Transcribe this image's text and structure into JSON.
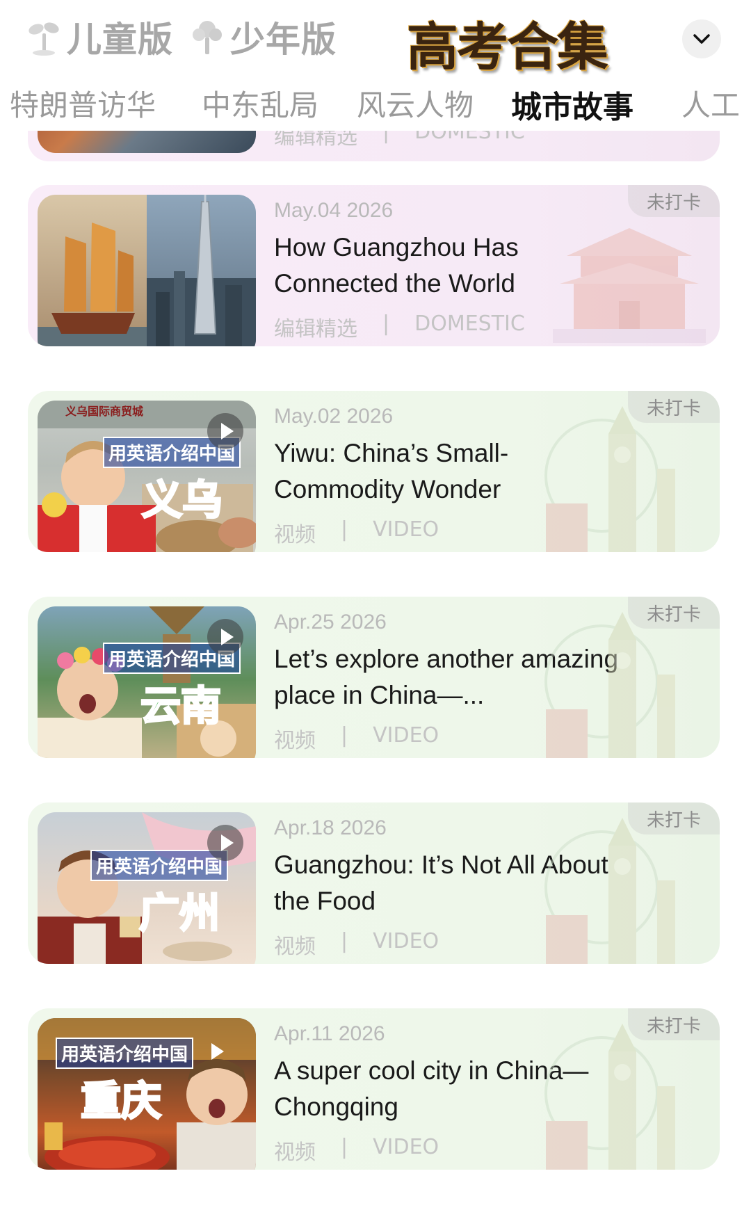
{
  "header": {
    "editions": [
      {
        "label": "儿童版",
        "icon": "sprout-icon"
      },
      {
        "label": "少年版",
        "icon": "tree-icon"
      }
    ],
    "collection_title": "高考合集",
    "expand_icon": "chevron-down-icon"
  },
  "tabs": [
    {
      "label": "特朗普访华"
    },
    {
      "label": "中东乱局"
    },
    {
      "label": "风云人物"
    },
    {
      "label": "城市故事",
      "active": true
    },
    {
      "label": "人工"
    }
  ],
  "partial_card": {
    "meta_left": "编辑精选",
    "meta_sep": "|",
    "meta_right": "DOMESTIC"
  },
  "cards": [
    {
      "date": "May.04 2026",
      "title": "How Guangzhou Has Connected the World",
      "meta_left": "编辑精选",
      "meta_sep": "|",
      "meta_right": "DOMESTIC",
      "badge": "未打卡",
      "theme": "pink",
      "video": false
    },
    {
      "date": "May.02 2026",
      "title": "Yiwu: China’s Small-Commodity Wonder",
      "meta_left": "视频",
      "meta_sep": "|",
      "meta_right": "VIDEO",
      "badge": "未打卡",
      "theme": "green",
      "video": true,
      "thumb_caption": "用英语介绍中国",
      "thumb_city": "义乌",
      "thumb_sign": "义乌国际商贸城"
    },
    {
      "date": "Apr.25 2026",
      "title": "Let’s explore another amazing place in China—...",
      "meta_left": "视频",
      "meta_sep": "|",
      "meta_right": "VIDEO",
      "badge": "未打卡",
      "theme": "green",
      "video": true,
      "thumb_caption": "用英语介绍中国",
      "thumb_city": "云南"
    },
    {
      "date": "Apr.18 2026",
      "title": "Guangzhou: It’s Not All About the Food",
      "meta_left": "视频",
      "meta_sep": "|",
      "meta_right": "VIDEO",
      "badge": "未打卡",
      "theme": "green",
      "video": true,
      "thumb_caption": "用英语介绍中国",
      "thumb_city": "广州"
    },
    {
      "date": "Apr.11 2026",
      "title": "A super cool city in China—Chongqing",
      "meta_left": "视频",
      "meta_sep": "|",
      "meta_right": "VIDEO",
      "badge": "未打卡",
      "theme": "green",
      "video": true,
      "thumb_caption": "用英语介绍中国",
      "thumb_city": "重庆"
    }
  ],
  "colors": {
    "card_pink": "#f7ebf7",
    "card_green": "#eff7eb",
    "muted_text": "#b9b9b9",
    "city_yiwu": "#e8452a",
    "city_yunnan": "#3fb54a",
    "city_guangzhou": "#d6338f",
    "city_chongqing": "#d42a1e"
  }
}
